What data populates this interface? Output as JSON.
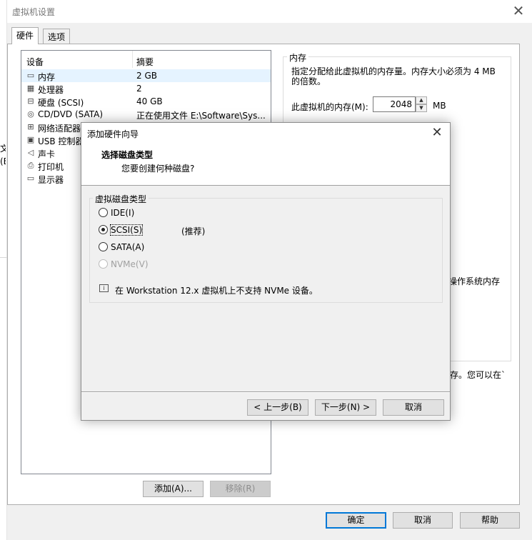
{
  "background": {
    "fragments": [
      "文",
      "(E"
    ]
  },
  "main": {
    "title": "虚拟机设置",
    "tabs": [
      {
        "label": "硬件",
        "active": true
      },
      {
        "label": "选项",
        "active": false
      }
    ],
    "device_list": {
      "headers": {
        "device": "设备",
        "summary": "摘要"
      },
      "rows": [
        {
          "icon": "memory-icon",
          "glyph": "▭",
          "name": "内存",
          "summary": "2 GB",
          "selected": true
        },
        {
          "icon": "processor-icon",
          "glyph": "▦",
          "name": "处理器",
          "summary": "2"
        },
        {
          "icon": "hard-disk-icon",
          "glyph": "⊟",
          "name": "硬盘 (SCSI)",
          "summary": "40 GB"
        },
        {
          "icon": "cd-dvd-icon",
          "glyph": "◎",
          "name": "CD/DVD (SATA)",
          "summary": "正在使用文件 E:\\Software\\Sys..."
        },
        {
          "icon": "network-adapter-icon",
          "glyph": "⊞",
          "name": "网络适配器",
          "summary": ""
        },
        {
          "icon": "usb-controller-icon",
          "glyph": "▣",
          "name": "USB 控制器",
          "summary": ""
        },
        {
          "icon": "sound-card-icon",
          "glyph": "◁",
          "name": "声卡",
          "summary": ""
        },
        {
          "icon": "printer-icon",
          "glyph": "⎙",
          "name": "打印机",
          "summary": ""
        },
        {
          "icon": "display-icon",
          "glyph": "▭",
          "name": "显示器",
          "summary": ""
        }
      ]
    },
    "memory": {
      "legend": "内存",
      "description": "指定分配给此虚拟机的内存量。内存大小必须为 4 MB 的倍数。",
      "label": "此虚拟机的内存(M):",
      "value": "2048",
      "unit": "MB",
      "fragment_os": "操作系统内存",
      "fragment_tail": "存。您可以在`"
    },
    "buttons": {
      "add": "添加(A)...",
      "remove": "移除(R)",
      "ok": "确定",
      "cancel": "取消",
      "help": "帮助"
    }
  },
  "wizard": {
    "title": "添加硬件向导",
    "heading": "选择磁盘类型",
    "subheading": "您要创建何种磁盘?",
    "group_label": "虚拟磁盘类型",
    "options": [
      {
        "label": "IDE(I)",
        "checked": false,
        "disabled": false
      },
      {
        "label": "SCSI(S)",
        "checked": true,
        "disabled": false,
        "note": "(推荐)"
      },
      {
        "label": "SATA(A)",
        "checked": false,
        "disabled": false
      },
      {
        "label": "NVMe(V)",
        "checked": false,
        "disabled": true
      }
    ],
    "info": "在 Workstation 12.x 虚拟机上不支持 NVMe 设备。",
    "buttons": {
      "back": "< 上一步(B)",
      "next": "下一步(N) >",
      "cancel": "取消"
    }
  }
}
